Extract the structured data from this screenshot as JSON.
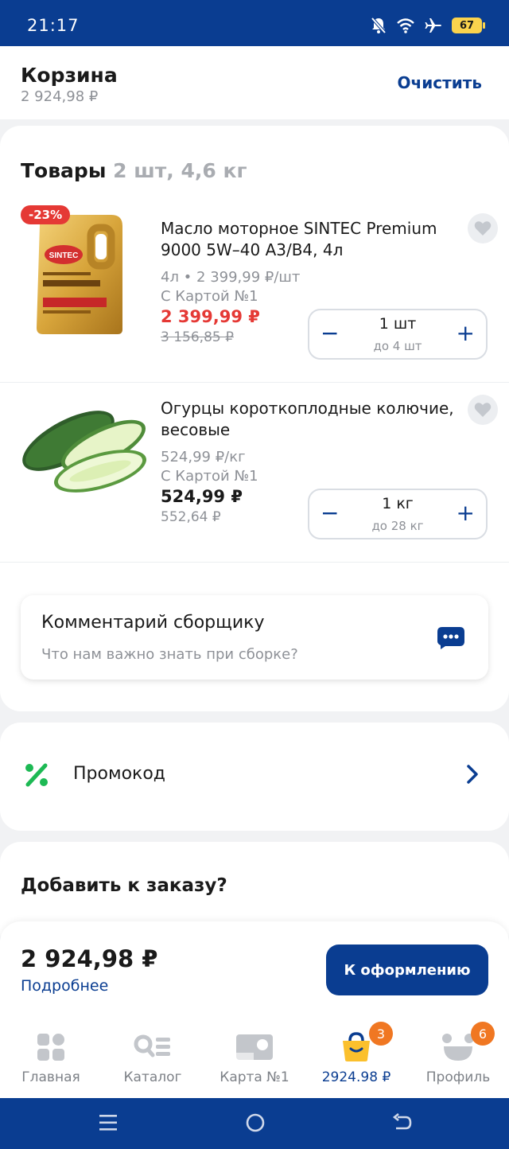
{
  "status": {
    "time": "21:17",
    "battery": "67"
  },
  "header": {
    "title": "Корзина",
    "subtitle": "2 924,98 ₽",
    "clear_label": "Очистить"
  },
  "items_section": {
    "title": "Товары",
    "meta": "2 шт, 4,6 кг"
  },
  "products": [
    {
      "discount": "-23%",
      "name": "Масло моторное SINTEC Premium 9000 5W–40 A3/B4, 4л",
      "unit_info": "4л • 2 399,99 ₽/шт",
      "card_note": "С Картой №1",
      "price": "2 399,99 ₽",
      "old_price": "3 156,85 ₽",
      "qty": "1 шт",
      "qty_limit": "до 4 шт",
      "image_icon": "motor-oil-canister",
      "price_color": "#e53935"
    },
    {
      "name": "Огурцы короткоплодные колючие, весовые",
      "unit_info": "524,99 ₽/кг",
      "card_note": "С Картой №1",
      "price": "524,99 ₽",
      "old_price": "552,64 ₽",
      "qty": "1 кг",
      "qty_limit": "до 28 кг",
      "image_icon": "cucumbers",
      "price_color": "#1a1a1a"
    }
  ],
  "stepper": {
    "minus": "−",
    "plus": "+"
  },
  "comment": {
    "title": "Комментарий сборщику",
    "placeholder": "Что нам важно знать при сборке?"
  },
  "promo": {
    "label": "Промокод"
  },
  "add_section": {
    "title": "Добавить к заказу?"
  },
  "checkout": {
    "total": "2 924,98 ₽",
    "details_label": "Подробнее",
    "button_label": "К оформлению"
  },
  "tabs": [
    {
      "label": "Главная",
      "icon": "home-grid-icon"
    },
    {
      "label": "Каталог",
      "icon": "catalog-icon"
    },
    {
      "label": "Карта №1",
      "icon": "loyalty-card-icon"
    },
    {
      "label": "2924.98 ₽",
      "icon": "cart-bag-icon",
      "badge": "3",
      "active": true
    },
    {
      "label": "Профиль",
      "icon": "profile-icon",
      "badge": "6"
    }
  ],
  "colors": {
    "brand": "#0a3d91",
    "sale": "#e53935",
    "promo": "#1db954",
    "badge": "#f07722",
    "cart_icon": "#fbc02d"
  }
}
